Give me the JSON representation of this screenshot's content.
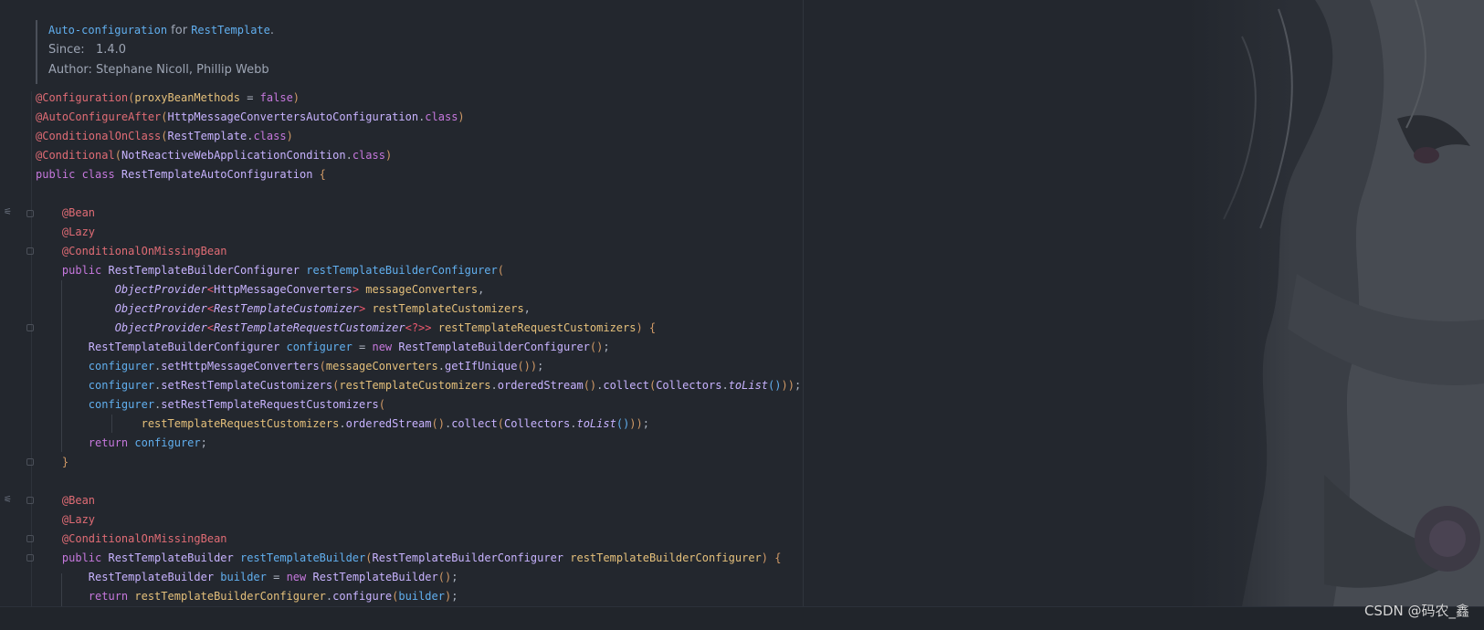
{
  "doc": {
    "summary_link": "Auto-configuration",
    "summary_for": " for ",
    "summary_class": "RestTemplate",
    "summary_end": ".",
    "since_label": "Since:",
    "since_value": "1.4.0",
    "author_label": "Author:",
    "author_value": "Stephane Nicoll, Phillip Webb"
  },
  "code_lines": [
    [
      [
        "ann",
        "@Configuration"
      ],
      [
        "br",
        "("
      ],
      [
        "id",
        "proxyBeanMethods"
      ],
      [
        "pn",
        " = "
      ],
      [
        "kw",
        "false"
      ],
      [
        "br",
        ")"
      ]
    ],
    [
      [
        "ann",
        "@AutoConfigureAfter"
      ],
      [
        "br",
        "("
      ],
      [
        "ty",
        "HttpMessageConvertersAutoConfiguration"
      ],
      [
        "pn",
        "."
      ],
      [
        "kw",
        "class"
      ],
      [
        "br",
        ")"
      ]
    ],
    [
      [
        "ann",
        "@ConditionalOnClass"
      ],
      [
        "br",
        "("
      ],
      [
        "ty",
        "RestTemplate"
      ],
      [
        "pn",
        "."
      ],
      [
        "kw",
        "class"
      ],
      [
        "br",
        ")"
      ]
    ],
    [
      [
        "ann",
        "@Conditional"
      ],
      [
        "br",
        "("
      ],
      [
        "ty",
        "NotReactiveWebApplicationCondition"
      ],
      [
        "pn",
        "."
      ],
      [
        "kw",
        "class"
      ],
      [
        "br",
        ")"
      ]
    ],
    [
      [
        "kw",
        "public class "
      ],
      [
        "ty",
        "RestTemplateAutoConfiguration "
      ],
      [
        "br",
        "{"
      ]
    ],
    [],
    [
      [
        "pn",
        "    "
      ],
      [
        "ann",
        "@Bean"
      ]
    ],
    [
      [
        "pn",
        "    "
      ],
      [
        "ann",
        "@Lazy"
      ]
    ],
    [
      [
        "pn",
        "    "
      ],
      [
        "ann",
        "@ConditionalOnMissingBean"
      ]
    ],
    [
      [
        "pn",
        "    "
      ],
      [
        "kw",
        "public "
      ],
      [
        "ty",
        "RestTemplateBuilderConfigurer "
      ],
      [
        "fn",
        "restTemplateBuilderConfigurer"
      ],
      [
        "br",
        "("
      ]
    ],
    [
      [
        "pn",
        "            "
      ],
      [
        "ty it",
        "ObjectProvider"
      ],
      [
        "ob",
        "<"
      ],
      [
        "ty",
        "HttpMessageConverters"
      ],
      [
        "ob",
        "> "
      ],
      [
        "id",
        "messageConverters"
      ],
      [
        "pn",
        ","
      ]
    ],
    [
      [
        "pn",
        "            "
      ],
      [
        "ty it",
        "ObjectProvider"
      ],
      [
        "ob",
        "<"
      ],
      [
        "ty it",
        "RestTemplateCustomizer"
      ],
      [
        "ob",
        "> "
      ],
      [
        "id",
        "restTemplateCustomizers"
      ],
      [
        "pn",
        ","
      ]
    ],
    [
      [
        "pn",
        "            "
      ],
      [
        "ty it",
        "ObjectProvider"
      ],
      [
        "ob",
        "<"
      ],
      [
        "ty it",
        "RestTemplateRequestCustomizer"
      ],
      [
        "ob",
        "<?>> "
      ],
      [
        "id",
        "restTemplateRequestCustomizers"
      ],
      [
        "br",
        ") {"
      ]
    ],
    [
      [
        "pn",
        "        "
      ],
      [
        "ty",
        "RestTemplateBuilderConfigurer "
      ],
      [
        "fn",
        "configurer"
      ],
      [
        "pn",
        " = "
      ],
      [
        "kw",
        "new "
      ],
      [
        "ty",
        "RestTemplateBuilderConfigurer"
      ],
      [
        "br",
        "()"
      ],
      [
        "pn",
        ";"
      ]
    ],
    [
      [
        "pn",
        "        "
      ],
      [
        "fn",
        "configurer"
      ],
      [
        "pn",
        "."
      ],
      [
        "ty",
        "setHttpMessageConverters"
      ],
      [
        "br",
        "("
      ],
      [
        "id",
        "messageConverters"
      ],
      [
        "pn",
        "."
      ],
      [
        "ty",
        "getIfUnique"
      ],
      [
        "br",
        "()"
      ],
      [
        "br",
        ")"
      ],
      [
        "pn",
        ";"
      ]
    ],
    [
      [
        "pn",
        "        "
      ],
      [
        "fn",
        "configurer"
      ],
      [
        "pn",
        "."
      ],
      [
        "ty",
        "setRestTemplateCustomizers"
      ],
      [
        "br",
        "("
      ],
      [
        "id",
        "restTemplateCustomizers"
      ],
      [
        "pn",
        "."
      ],
      [
        "ty",
        "orderedStream"
      ],
      [
        "br",
        "()"
      ],
      [
        "pn",
        "."
      ],
      [
        "ty",
        "collect"
      ],
      [
        "br",
        "("
      ],
      [
        "ty",
        "Collectors"
      ],
      [
        "pn",
        "."
      ],
      [
        "ty it",
        "toList"
      ],
      [
        "fn",
        "()"
      ],
      [
        "br",
        "))"
      ],
      [
        "pn",
        ";"
      ]
    ],
    [
      [
        "pn",
        "        "
      ],
      [
        "fn",
        "configurer"
      ],
      [
        "pn",
        "."
      ],
      [
        "ty",
        "setRestTemplateRequestCustomizers"
      ],
      [
        "br",
        "("
      ]
    ],
    [
      [
        "pn",
        "                "
      ],
      [
        "id",
        "restTemplateRequestCustomizers"
      ],
      [
        "pn",
        "."
      ],
      [
        "ty",
        "orderedStream"
      ],
      [
        "br",
        "()"
      ],
      [
        "pn",
        "."
      ],
      [
        "ty",
        "collect"
      ],
      [
        "br",
        "("
      ],
      [
        "ty",
        "Collectors"
      ],
      [
        "pn",
        "."
      ],
      [
        "ty it",
        "toList"
      ],
      [
        "fn",
        "()"
      ],
      [
        "br",
        "))"
      ],
      [
        "pn",
        ";"
      ]
    ],
    [
      [
        "pn",
        "        "
      ],
      [
        "kw",
        "return "
      ],
      [
        "fn",
        "configurer"
      ],
      [
        "pn",
        ";"
      ]
    ],
    [
      [
        "pn",
        "    "
      ],
      [
        "br",
        "}"
      ]
    ],
    [],
    [
      [
        "pn",
        "    "
      ],
      [
        "ann",
        "@Bean"
      ]
    ],
    [
      [
        "pn",
        "    "
      ],
      [
        "ann",
        "@Lazy"
      ]
    ],
    [
      [
        "pn",
        "    "
      ],
      [
        "ann",
        "@ConditionalOnMissingBean"
      ]
    ],
    [
      [
        "pn",
        "    "
      ],
      [
        "kw",
        "public "
      ],
      [
        "ty",
        "RestTemplateBuilder "
      ],
      [
        "fn",
        "restTemplateBuilder"
      ],
      [
        "br",
        "("
      ],
      [
        "ty",
        "RestTemplateBuilderConfigurer "
      ],
      [
        "id",
        "restTemplateBuilderConfigurer"
      ],
      [
        "br",
        ") {"
      ]
    ],
    [
      [
        "pn",
        "        "
      ],
      [
        "ty",
        "RestTemplateBuilder "
      ],
      [
        "fn",
        "builder"
      ],
      [
        "pn",
        " = "
      ],
      [
        "kw",
        "new "
      ],
      [
        "ty",
        "RestTemplateBuilder"
      ],
      [
        "br",
        "()"
      ],
      [
        "pn",
        ";"
      ]
    ],
    [
      [
        "pn",
        "        "
      ],
      [
        "kw",
        "return "
      ],
      [
        "id",
        "restTemplateBuilderConfigurer"
      ],
      [
        "pn",
        "."
      ],
      [
        "ty",
        "configure"
      ],
      [
        "br",
        "("
      ],
      [
        "fn",
        "builder"
      ],
      [
        "br",
        ")"
      ],
      [
        "pn",
        ";"
      ]
    ]
  ],
  "watermark": "CSDN @码农_鑫",
  "colors": {
    "background": "#23272e",
    "annotation": "#e06c75",
    "keyword": "#c678dd",
    "type": "#c8b3ff",
    "identifier": "#e5c07b",
    "function": "#61afef"
  }
}
